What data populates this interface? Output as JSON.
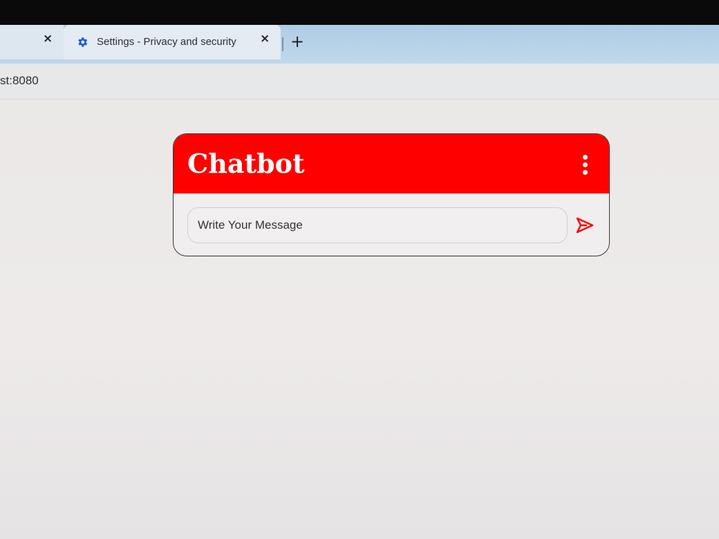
{
  "browser": {
    "tabs": [
      {
        "title": "",
        "close_glyph": "×",
        "icon": null
      },
      {
        "title": "Settings - Privacy and security",
        "close_glyph": "×",
        "icon": "gear-icon"
      }
    ],
    "new_tab_glyph": "+",
    "address_text": "st:8080"
  },
  "chatbot": {
    "title": "Chatbot",
    "input_placeholder": "Write Your Message",
    "input_value": "",
    "menu_icon": "vertical-dots-icon",
    "send_icon": "send-icon",
    "accent_color": "#ff0000"
  }
}
